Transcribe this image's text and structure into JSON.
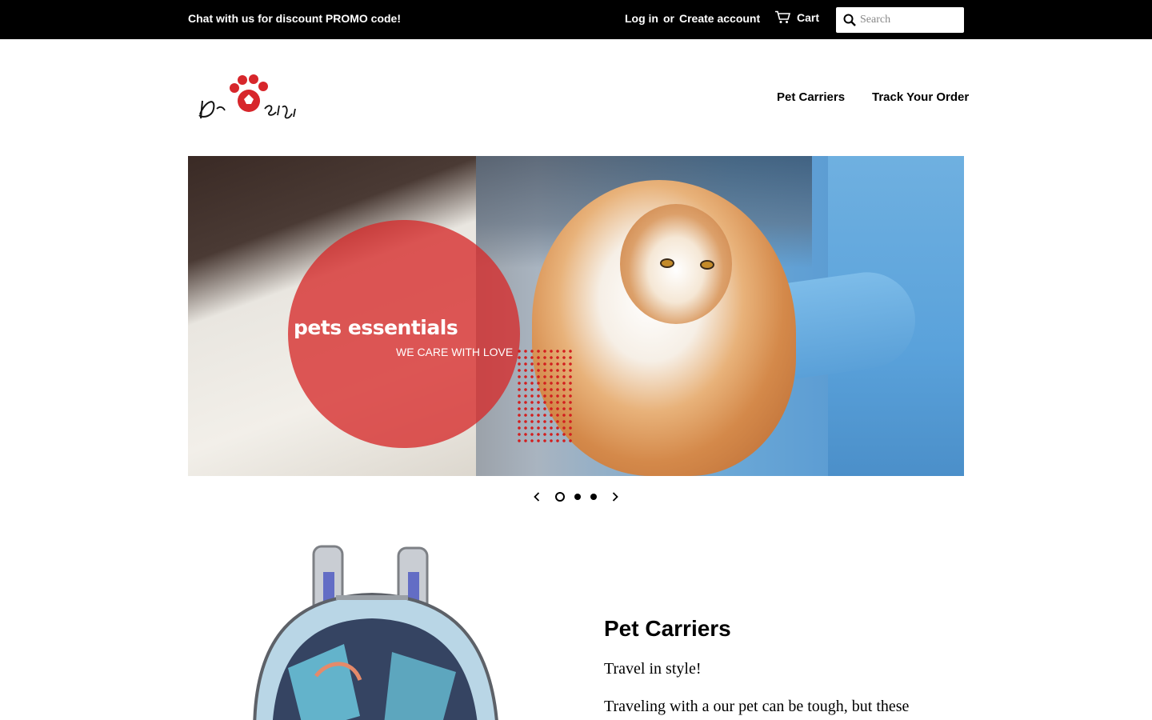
{
  "topbar": {
    "promo": "Chat with us for discount PROMO code!",
    "login": "Log in",
    "or": "or",
    "create_account": "Create account",
    "cart": "Cart",
    "search_placeholder": "Search"
  },
  "header": {
    "nav": [
      "Pet Carriers",
      "Track Your Order"
    ]
  },
  "hero": {
    "title": "pets essentials",
    "subtitle": "WE CARE WITH LOVE",
    "slide_count": 3,
    "active_slide": 1
  },
  "featured": {
    "title": "Pet Carriers",
    "tagline": "Travel in style!",
    "description": "Traveling with a our pet can be tough, but these"
  },
  "colors": {
    "topbar": "#000000",
    "accent_red": "#d62a2a"
  }
}
